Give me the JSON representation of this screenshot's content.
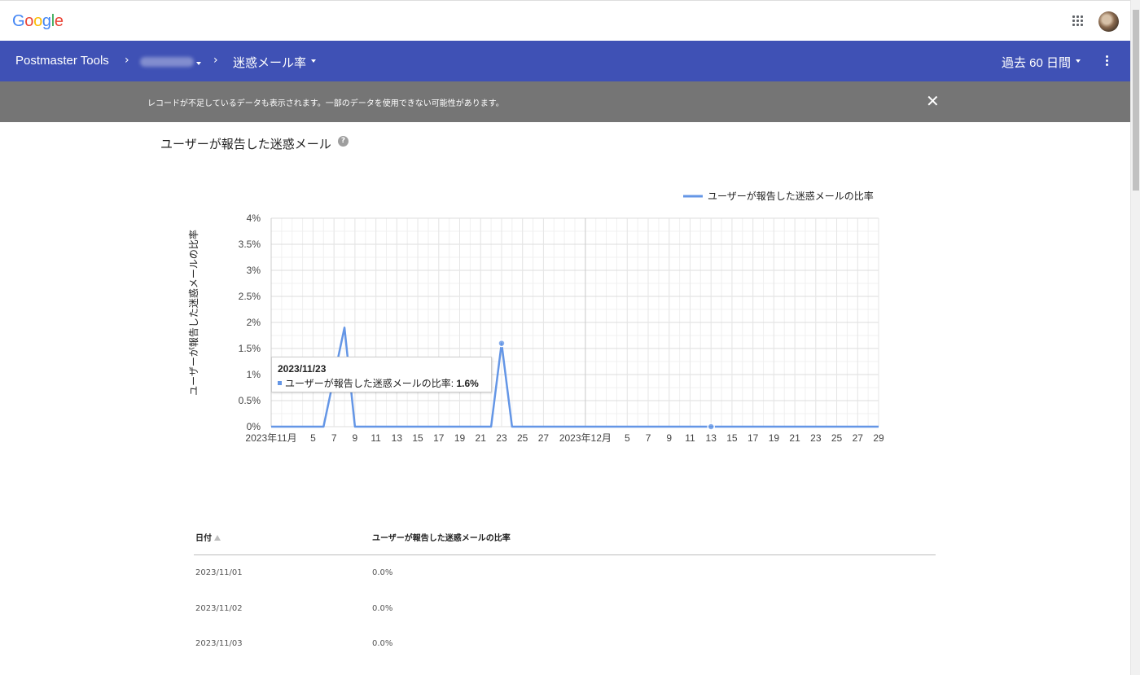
{
  "topbar": {
    "logo": "Google",
    "logo_colors": [
      "#4285F4",
      "#EA4335",
      "#FBBC05",
      "#4285F4",
      "#34A853",
      "#EA4335"
    ]
  },
  "appbar": {
    "product": "Postmaster Tools",
    "domain_placeholder": "",
    "page": "迷惑メール率",
    "range": "過去 60 日間",
    "color": "#3f51b5"
  },
  "banner": {
    "message": "レコードが不足しているデータも表示されます。一部のデータを使用できない可能性があります。",
    "close": "✕"
  },
  "section": {
    "title": "ユーザーが報告した迷惑メール",
    "help": "?"
  },
  "chart_data": {
    "type": "line",
    "ylabel": "ユーザーが報告した迷惑メールの比率",
    "legend": "ユーザーが報告した迷惑メールの比率",
    "legend_position": "top-right",
    "series_color": "#6496e6",
    "yticks": [
      "0%",
      "0.5%",
      "1%",
      "1.5%",
      "2%",
      "2.5%",
      "3%",
      "3.5%",
      "4%"
    ],
    "ylim": [
      0,
      4
    ],
    "xlim": [
      "2023-11-01",
      "2023-12-29"
    ],
    "xticks": [
      {
        "date": "2023-11-01",
        "label": "2023年11月"
      },
      {
        "date": "2023-11-05",
        "label": "5"
      },
      {
        "date": "2023-11-07",
        "label": "7"
      },
      {
        "date": "2023-11-09",
        "label": "9"
      },
      {
        "date": "2023-11-11",
        "label": "11"
      },
      {
        "date": "2023-11-13",
        "label": "13"
      },
      {
        "date": "2023-11-15",
        "label": "15"
      },
      {
        "date": "2023-11-17",
        "label": "17"
      },
      {
        "date": "2023-11-19",
        "label": "19"
      },
      {
        "date": "2023-11-21",
        "label": "21"
      },
      {
        "date": "2023-11-23",
        "label": "23"
      },
      {
        "date": "2023-11-25",
        "label": "25"
      },
      {
        "date": "2023-11-27",
        "label": "27"
      },
      {
        "date": "2023-12-01",
        "label": "2023年12月"
      },
      {
        "date": "2023-12-05",
        "label": "5"
      },
      {
        "date": "2023-12-07",
        "label": "7"
      },
      {
        "date": "2023-12-09",
        "label": "9"
      },
      {
        "date": "2023-12-11",
        "label": "11"
      },
      {
        "date": "2023-12-13",
        "label": "13"
      },
      {
        "date": "2023-12-15",
        "label": "15"
      },
      {
        "date": "2023-12-17",
        "label": "17"
      },
      {
        "date": "2023-12-19",
        "label": "19"
      },
      {
        "date": "2023-12-21",
        "label": "21"
      },
      {
        "date": "2023-12-23",
        "label": "23"
      },
      {
        "date": "2023-12-25",
        "label": "25"
      },
      {
        "date": "2023-12-27",
        "label": "27"
      },
      {
        "date": "2023-12-29",
        "label": "29"
      }
    ],
    "points": [
      {
        "x": "2023-11-01",
        "y": 0
      },
      {
        "x": "2023-11-06",
        "y": 0
      },
      {
        "x": "2023-11-08",
        "y": 1.9
      },
      {
        "x": "2023-11-09",
        "y": 0
      },
      {
        "x": "2023-11-22",
        "y": 0
      },
      {
        "x": "2023-11-23",
        "y": 1.6
      },
      {
        "x": "2023-11-24",
        "y": 0
      },
      {
        "x": "2023-12-29",
        "y": 0
      }
    ],
    "highlighted_points": [
      "2023-11-23",
      "2023-12-13"
    ],
    "grid": true,
    "tooltip": {
      "date": "2023/11/23",
      "label": "ユーザーが報告した迷惑メールの比率:",
      "value": "1.6%"
    }
  },
  "table": {
    "headers": {
      "date": "日付",
      "rate": "ユーザーが報告した迷惑メールの比率"
    },
    "rows": [
      {
        "date": "2023/11/01",
        "rate": "0.0%"
      },
      {
        "date": "2023/11/02",
        "rate": "0.0%"
      },
      {
        "date": "2023/11/03",
        "rate": "0.0%"
      }
    ]
  }
}
